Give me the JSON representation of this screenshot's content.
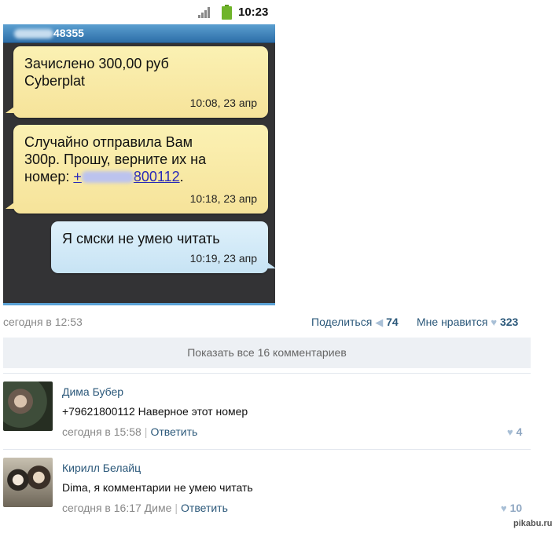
{
  "phone": {
    "clock": "10:23",
    "contact_number_suffix": "48355",
    "messages": [
      {
        "lines": [
          "Зачислено 300,00 руб",
          "Cyberplat"
        ],
        "time": "10:08, 23 апр"
      },
      {
        "lines": [
          "Случайно отправила Вам",
          "300р. Прошу, верните их на"
        ],
        "prefix": "номер: ",
        "link_start": "+",
        "link_end": "800112",
        "after_link": ".",
        "time": "10:18, 23 апр"
      },
      {
        "lines": [
          "Я смски не умею читать"
        ],
        "time": "10:19, 23 апр"
      }
    ]
  },
  "post": {
    "date": "сегодня в 12:53",
    "share_label": "Поделиться",
    "share_count": "74",
    "like_label": "Мне нравится",
    "like_count": "323",
    "show_all": "Показать все 16 комментариев"
  },
  "comments": [
    {
      "author": "Дима Бубер",
      "text": "+79621800112 Наверное этот номер",
      "date": "сегодня в 15:58",
      "reply": "Ответить",
      "likes": "4"
    },
    {
      "author": "Кирилл Белайц",
      "text": "Dima, я комментарии не умею читать",
      "date": "сегодня в 16:17 Диме",
      "reply": "Ответить",
      "likes": "10"
    }
  ],
  "watermark": "pikabu.ru",
  "colors": {
    "link": "#2b587a",
    "bubble_in": "#f6e39a",
    "bubble_out": "#c7e3f4",
    "phone_bg": "#333335"
  }
}
